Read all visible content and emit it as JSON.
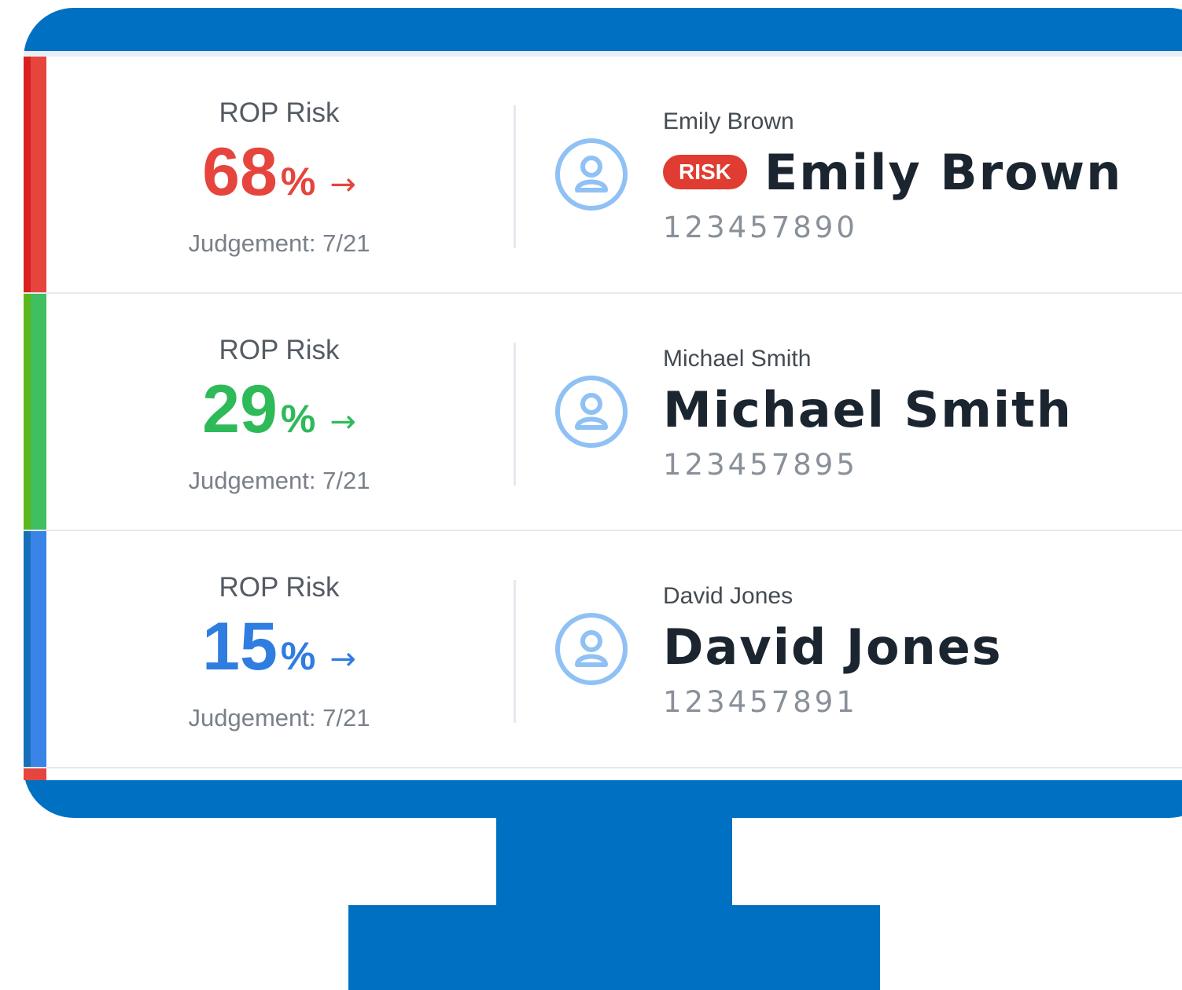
{
  "colors": {
    "bezel": "#0071c2",
    "high_risk": "#e5453d",
    "low_risk": "#2fba5a",
    "very_low_risk": "#2f7de1",
    "avatar": "#8fc1f5",
    "badge": "#e03c31"
  },
  "patients": [
    {
      "risk_label": "ROP Risk",
      "risk_value": "68",
      "risk_unit": "%",
      "arrow": "→",
      "judgement": "Judgement: 7/21",
      "name_small": "Emily Brown",
      "badge": "RISK",
      "name_big": "Emily Brown",
      "id": "123457890",
      "icon": "user-avatar-icon"
    },
    {
      "risk_label": "ROP Risk",
      "risk_value": "29",
      "risk_unit": "%",
      "arrow": "→",
      "judgement": "Judgement: 7/21",
      "name_small": "Michael Smith",
      "name_big": "Michael Smith",
      "id": "123457895",
      "icon": "user-avatar-icon"
    },
    {
      "risk_label": "ROP Risk",
      "risk_value": "15",
      "risk_unit": "%",
      "arrow": "→",
      "judgement": "Judgement: 7/21",
      "name_small": "David Jones",
      "name_big": "David Jones",
      "id": "123457891",
      "icon": "user-avatar-icon"
    }
  ]
}
